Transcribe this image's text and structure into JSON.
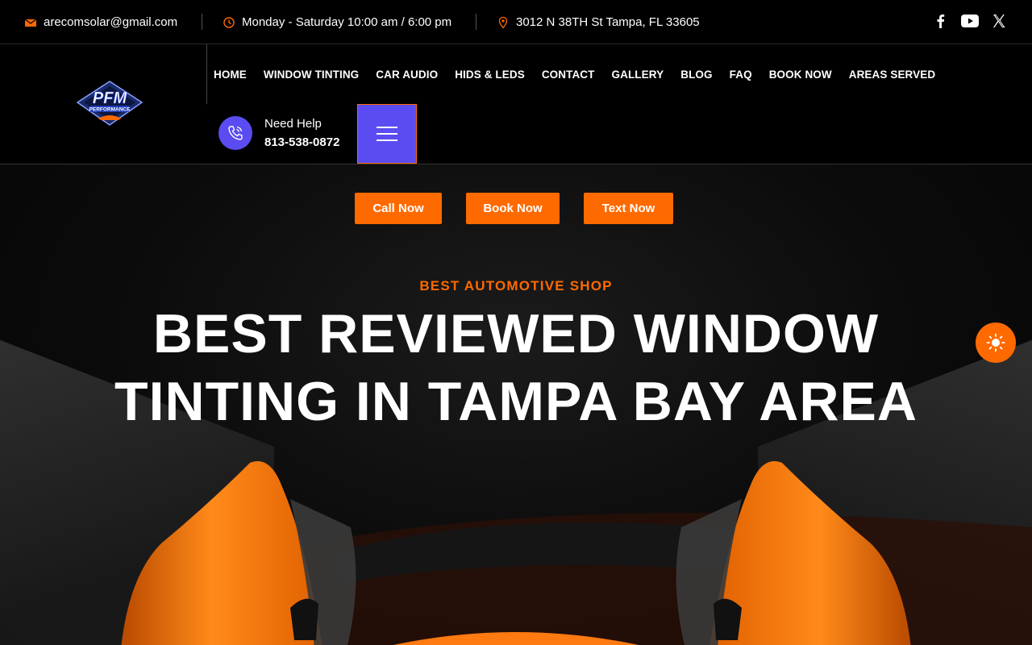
{
  "topbar": {
    "email": "arecomsolar@gmail.com",
    "hours": "Monday - Saturday 10:00 am / 6:00 pm",
    "address": "3012 N 38TH St Tampa, FL 33605",
    "social": [
      "facebook-icon",
      "youtube-icon",
      "x-icon"
    ]
  },
  "header": {
    "logo_text": "PFM",
    "logo_subtext": "PERFORMANCE",
    "nav": [
      {
        "label": "HOME"
      },
      {
        "label": "WINDOW TINTING"
      },
      {
        "label": "CAR AUDIO"
      },
      {
        "label": "HIDS & LEDS"
      },
      {
        "label": "CONTACT"
      },
      {
        "label": "GALLERY"
      },
      {
        "label": "BLOG"
      },
      {
        "label": "FAQ"
      },
      {
        "label": "BOOK NOW"
      },
      {
        "label": "AREAS SERVED"
      }
    ],
    "help_label": "Need Help",
    "help_phone": "813-538-0872"
  },
  "hero": {
    "buttons": [
      {
        "label": "Call Now"
      },
      {
        "label": "Book Now"
      },
      {
        "label": "Text Now"
      }
    ],
    "kicker": "BEST AUTOMOTIVE SHOP",
    "headline_line1": "BEST REVIEWED WINDOW",
    "headline_line2": "TINTING IN TAMPA BAY AREA"
  },
  "colors": {
    "accent": "#ff6a00",
    "brand_purple": "#5a4cf0",
    "background": "#000000"
  }
}
